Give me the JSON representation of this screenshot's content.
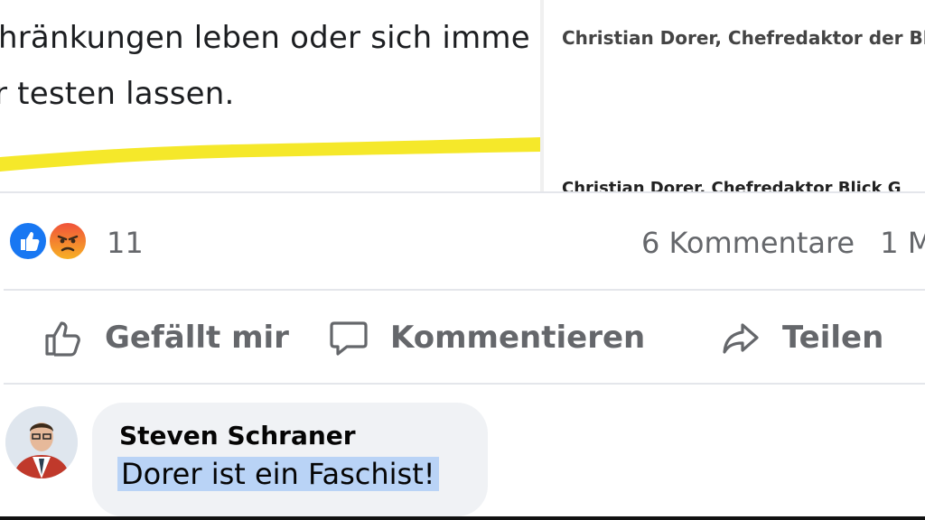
{
  "post": {
    "text_line_1": "hränkungen leben oder sich imme",
    "text_line_2": "r testen lassen.",
    "image_caption_1": "Christian Dorer, Chefredaktor der Bli",
    "image_caption_2": "Christian Dorer, Chefredaktor Blick G"
  },
  "reactions": {
    "icons": [
      "like-icon",
      "angry-icon"
    ],
    "count": "11",
    "comments": "6 Kommentare",
    "more": "1 M"
  },
  "actions": {
    "like": "Gefällt mir",
    "comment": "Kommentieren",
    "share": "Teilen"
  },
  "comment": {
    "author": "Steven Schraner",
    "text": "Dorer ist ein Faschist!"
  },
  "colors": {
    "highlight": "#f5e82a",
    "selection": "#b9d3f6",
    "like_blue": "#1877f2",
    "bubble": "#f0f2f5"
  }
}
